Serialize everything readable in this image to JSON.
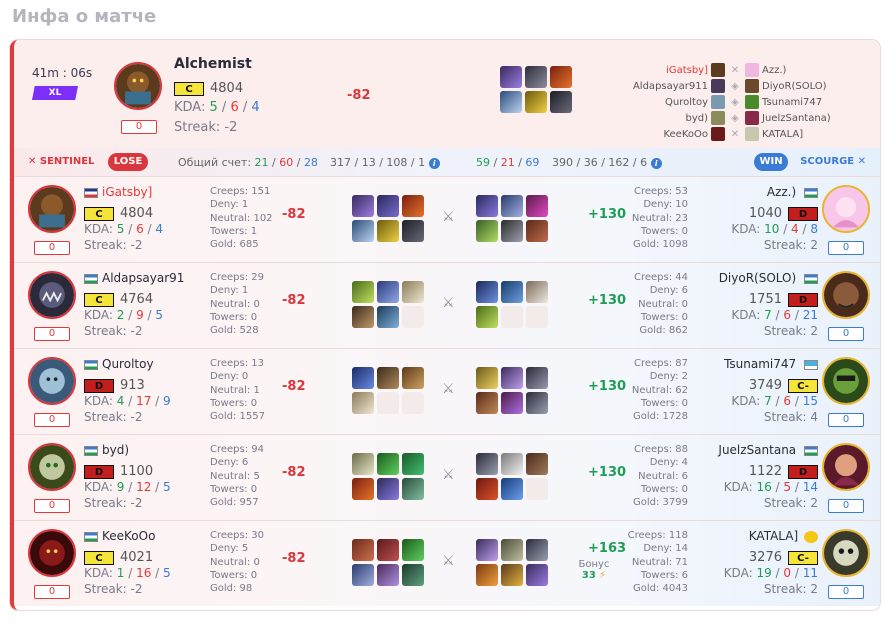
{
  "page_title": "Инфа о матче",
  "summary": {
    "time": "41m : 06s",
    "tag": "XL",
    "hero": "Alchemist",
    "rank": "C",
    "rating": "4804",
    "kda_label": "KDA:",
    "kda": {
      "k": "5",
      "d": "6",
      "a": "4"
    },
    "streak": "Streak: -2",
    "mmr": "0",
    "delta": "-82",
    "matchups": [
      {
        "left": "iGatsby]",
        "right": "Azz.)",
        "highlight": true
      },
      {
        "left": "Aldapsayar911",
        "right": "DiyoR(SOLO)",
        "highlight": false
      },
      {
        "left": "Quroltoy",
        "right": "Tsunami747",
        "highlight": false
      },
      {
        "left": "byd)",
        "right": "JuelzSantana)",
        "highlight": false
      },
      {
        "left": "KeeKoOo",
        "right": "KATALA]",
        "highlight": false
      }
    ]
  },
  "scorebar": {
    "sentinel": "SENTINEL",
    "lose": "LOSE",
    "score_label": "Общий счет:",
    "left_k": "21",
    "left_d": "60",
    "left_a": "28",
    "left_stats": "317 / 13 / 108 / 1",
    "right_k": "59",
    "right_d": "21",
    "right_a": "69",
    "right_stats": "390 / 36 / 162 / 6",
    "win": "WIN",
    "scourge": "SCOURGE"
  },
  "rows": [
    {
      "left": {
        "name": "iGatsby]",
        "rank": "C",
        "rating": "4804",
        "k": "5",
        "d": "6",
        "a": "4",
        "streak": "Streak: -2",
        "mmr": "0",
        "creeps": "Creeps: 151",
        "deny": "Deny: 1",
        "neutral": "Neutral: 102",
        "towers": "Towers: 1",
        "gold": "Gold: 685",
        "delta": "-82"
      },
      "right": {
        "name": "Azz.)",
        "rank": "D",
        "rating": "1040",
        "k": "10",
        "d": "4",
        "a": "8",
        "streak": "Streak: 2",
        "mmr": "0",
        "creeps": "Creeps: 53",
        "deny": "Deny: 10",
        "neutral": "Neutral: 23",
        "towers": "Towers: 0",
        "gold": "Gold: 1098",
        "delta": "+130"
      }
    },
    {
      "left": {
        "name": "Aldapsayar91",
        "rank": "C",
        "rating": "4764",
        "k": "2",
        "d": "9",
        "a": "5",
        "streak": "Streak: -2",
        "mmr": "0",
        "creeps": "Creeps: 29",
        "deny": "Deny: 1",
        "neutral": "Neutral: 0",
        "towers": "Towers: 0",
        "gold": "Gold: 528",
        "delta": "-82"
      },
      "right": {
        "name": "DiyoR(SOLO)",
        "rank": "D",
        "rating": "1751",
        "k": "7",
        "d": "6",
        "a": "21",
        "streak": "Streak: 2",
        "mmr": "0",
        "creeps": "Creeps: 44",
        "deny": "Deny: 6",
        "neutral": "Neutral: 0",
        "towers": "Towers: 0",
        "gold": "Gold: 862",
        "delta": "+130"
      }
    },
    {
      "left": {
        "name": "Quroltoy",
        "rank": "D",
        "rating": "913",
        "k": "4",
        "d": "17",
        "a": "9",
        "streak": "Streak: -2",
        "mmr": "0",
        "creeps": "Creeps: 13",
        "deny": "Deny: 0",
        "neutral": "Neutral: 1",
        "towers": "Towers: 0",
        "gold": "Gold: 1557",
        "delta": "-82"
      },
      "right": {
        "name": "Tsunami747",
        "rank": "C-",
        "rating": "3749",
        "k": "7",
        "d": "6",
        "a": "15",
        "streak": "Streak: 4",
        "mmr": "0",
        "creeps": "Creeps: 87",
        "deny": "Deny: 2",
        "neutral": "Neutral: 62",
        "towers": "Towers: 0",
        "gold": "Gold: 1728",
        "delta": "+130"
      }
    },
    {
      "left": {
        "name": "byd)",
        "rank": "D",
        "rating": "1100",
        "k": "9",
        "d": "12",
        "a": "5",
        "streak": "Streak: -2",
        "mmr": "0",
        "creeps": "Creeps: 94",
        "deny": "Deny: 6",
        "neutral": "Neutral: 5",
        "towers": "Towers: 0",
        "gold": "Gold: 957",
        "delta": "-82"
      },
      "right": {
        "name": "JuelzSantana",
        "rank": "D",
        "rating": "1122",
        "k": "16",
        "d": "5",
        "a": "14",
        "streak": "Streak: 2",
        "mmr": "0",
        "creeps": "Creeps: 88",
        "deny": "Deny: 4",
        "neutral": "Neutral: 6",
        "towers": "Towers: 0",
        "gold": "Gold: 3799",
        "delta": "+130"
      }
    },
    {
      "left": {
        "name": "KeeKoOo",
        "rank": "C",
        "rating": "4021",
        "k": "1",
        "d": "16",
        "a": "5",
        "streak": "Streak: -2",
        "mmr": "0",
        "creeps": "Creeps: 30",
        "deny": "Deny: 5",
        "neutral": "Neutral: 0",
        "towers": "Towers: 0",
        "gold": "Gold: 98",
        "delta": "-82"
      },
      "right": {
        "name": "KATALA]",
        "rank": "C-",
        "rating": "3276",
        "k": "19",
        "d": "0",
        "a": "11",
        "streak": "Streak: 2",
        "mmr": "0",
        "creeps": "Creeps: 118",
        "deny": "Deny: 14",
        "neutral": "Neutral: 71",
        "towers": "Towers: 6",
        "gold": "Gold: 4043",
        "delta": "+163",
        "bonus_label": "Бонус",
        "bonus_value": "33"
      }
    }
  ]
}
